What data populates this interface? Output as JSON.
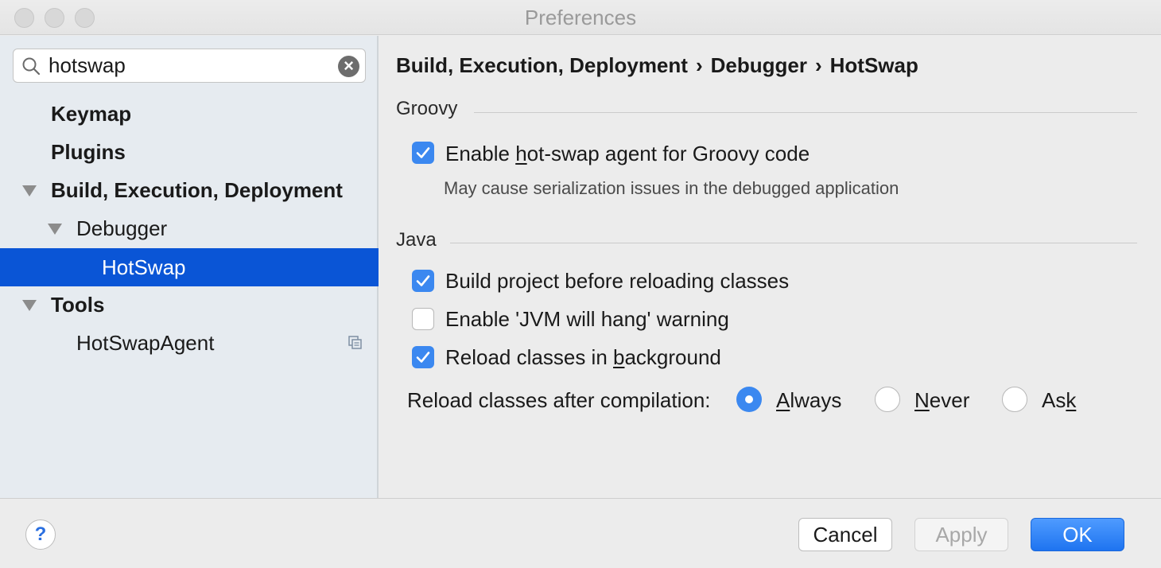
{
  "window": {
    "title": "Preferences"
  },
  "sidebar": {
    "search": {
      "value": "hotswap",
      "placeholder": ""
    },
    "items": [
      {
        "label": "Keymap"
      },
      {
        "label": "Plugins"
      },
      {
        "label": "Build, Execution, Deployment"
      },
      {
        "label": "Debugger"
      },
      {
        "label": "HotSwap"
      },
      {
        "label": "Tools"
      },
      {
        "label": "HotSwapAgent"
      }
    ]
  },
  "content": {
    "breadcrumb": [
      "Build, Execution, Deployment",
      "Debugger",
      "HotSwap"
    ],
    "breadcrumb_sep": "›",
    "groovy": {
      "section_title": "Groovy",
      "enable_agent": {
        "checked": true,
        "label_pre": "Enable ",
        "label_mnemonic": "h",
        "label_post": "ot-swap agent for Groovy code"
      },
      "hint": "May cause serialization issues in the debugged application"
    },
    "java": {
      "section_title": "Java",
      "build_project": {
        "checked": true,
        "label": "Build project before reloading classes"
      },
      "jvm_hang": {
        "checked": false,
        "label": "Enable 'JVM will hang' warning"
      },
      "reload_background": {
        "checked": true,
        "label_pre": "Reload classes in ",
        "label_mnemonic": "b",
        "label_post": "ackground"
      },
      "reload_after": {
        "label": "Reload classes after compilation:",
        "selected": "Always",
        "options": [
          {
            "pre": "",
            "mnemonic": "A",
            "post": "lways"
          },
          {
            "pre": "",
            "mnemonic": "N",
            "post": "ever"
          },
          {
            "pre": "As",
            "mnemonic": "k",
            "post": ""
          }
        ]
      }
    }
  },
  "footer": {
    "help_label": "?",
    "cancel_label": "Cancel",
    "apply_label": "Apply",
    "ok_label": "OK"
  },
  "colors": {
    "accent": "#3b88f0",
    "selection": "#0a55d6",
    "sidebar_bg": "#e6ebf0"
  }
}
